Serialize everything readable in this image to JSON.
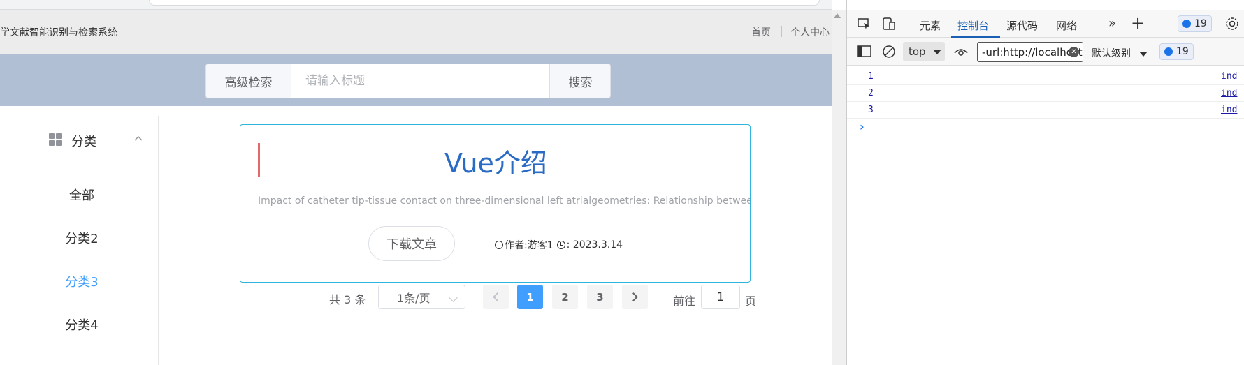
{
  "app": {
    "title": "学文献智能识别与检索系统",
    "nav": {
      "home": "首页",
      "profile": "个人中心"
    }
  },
  "search": {
    "advanced_label": "高级检索",
    "placeholder": "请输入标题",
    "value": "",
    "button_label": "搜索"
  },
  "sidebar": {
    "header_label": "分类",
    "items": [
      {
        "label": "全部",
        "active": false
      },
      {
        "label": "分类2",
        "active": false
      },
      {
        "label": "分类3",
        "active": true
      },
      {
        "label": "分类4",
        "active": false
      }
    ]
  },
  "article": {
    "title": "Vue介绍",
    "abstract": "Impact of catheter tip-tissue contact on three-dimensional left atrialgeometries: Relationship between the extent",
    "download_label": "下载文章",
    "author": "作者:游客1",
    "date": ": 2023.3.14"
  },
  "pagination": {
    "total": "共 3 条",
    "page_size": "1条/页",
    "pages": [
      "1",
      "2",
      "3"
    ],
    "current_page": "1",
    "goto_label": "前往",
    "goto_value": "1",
    "page_suffix": "页"
  },
  "devtools": {
    "tabs": [
      "元素",
      "控制台",
      "源代码",
      "网络"
    ],
    "active_tab": "控制台",
    "issue_count": "19",
    "context": "top",
    "filter_value": "-url:http://localhost",
    "level": "默认级别",
    "message_count": "19",
    "logs": [
      {
        "value": "1",
        "source": "ind"
      },
      {
        "value": "2",
        "source": "ind"
      },
      {
        "value": "3",
        "source": "ind"
      }
    ],
    "prompt": "›"
  },
  "colors": {
    "accent": "#409eff",
    "card_border": "#2fb4de",
    "title_blue": "#2a6bc3",
    "search_band": "#b0bfd3",
    "card_bar": "#e5686a"
  }
}
